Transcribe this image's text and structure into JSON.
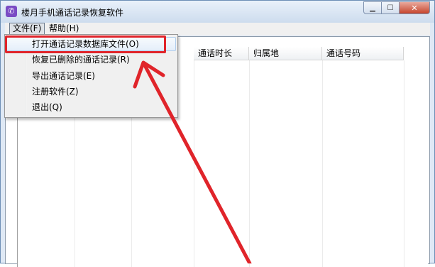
{
  "window": {
    "title": "楼月手机通话记录恢复软件"
  },
  "menubar": {
    "file": "文件(F)",
    "help": "帮助(H)"
  },
  "file_menu": {
    "items": [
      {
        "label": "打开通话记录数据库文件(O)"
      },
      {
        "label": "恢复已删除的通话记录(R)"
      },
      {
        "label": "导出通话记录(E)"
      },
      {
        "label": "注册软件(Z)"
      },
      {
        "label": "退出(Q)"
      }
    ]
  },
  "table": {
    "columns": [
      "通话时长",
      "归属地",
      "通话号码"
    ]
  },
  "colors": {
    "annotation": "#e0242a"
  },
  "icons": {
    "app": "phone-app-icon",
    "minimize": "minimize-icon",
    "maximize": "maximize-icon",
    "close": "close-icon"
  }
}
